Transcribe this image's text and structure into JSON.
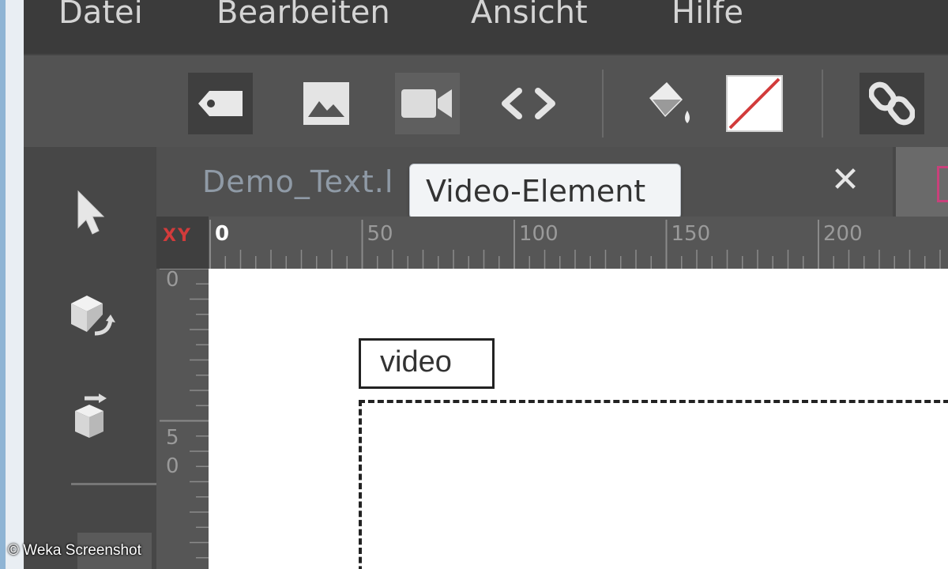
{
  "menu": {
    "items": [
      {
        "label": "Datei"
      },
      {
        "label": "Bearbeiten"
      },
      {
        "label": "Ansicht"
      },
      {
        "label": "Hilfe"
      }
    ]
  },
  "toolbar": {
    "icons": [
      "label-tag-icon",
      "image-icon",
      "video-camera-icon",
      "code-brackets-icon",
      "paint-bucket-icon",
      "no-fill-swatch-icon",
      "link-icon"
    ]
  },
  "left_tools": {
    "icons": [
      "selection-arrow-icon",
      "rotate-3d-icon",
      "move-3d-icon"
    ]
  },
  "tab": {
    "title": "Demo_Text.l",
    "close_label": "✕"
  },
  "tooltip": {
    "text": "Video-Element"
  },
  "ruler": {
    "corner_label": "XY",
    "h_labels": [
      "0",
      "50",
      "100",
      "150",
      "200"
    ],
    "v_labels": [
      "0",
      "5",
      "0"
    ]
  },
  "canvas": {
    "element_label": "video"
  },
  "watermark": "© Weka Screenshot",
  "colors": {
    "menubar": "#3b3b3b",
    "toolbar": "#535353",
    "panel": "#474747",
    "accent_red": "#d23b3b",
    "tab_accent": "#c8407a"
  }
}
